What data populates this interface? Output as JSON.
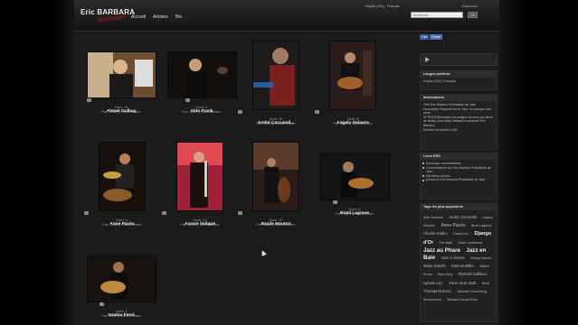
{
  "site": {
    "logo_text": "Eric BARBARA",
    "logo_sub": "Jazzimages"
  },
  "nav": [
    {
      "label": "Accueil"
    },
    {
      "label": "Artistes"
    },
    {
      "label": "Bio"
    }
  ],
  "top_links": {
    "lang_en": "English (US)",
    "sep": "|",
    "lang_fr": "Français",
    "login": "Connexion"
  },
  "search": {
    "placeholder": "rechercher",
    "button": "OK"
  },
  "albums": [
    {
      "name": "Ahmet Gulbay",
      "views": "Vues: 16",
      "owner": "Par: Gallery Administrator",
      "color": "#7a5a3a"
    },
    {
      "name": "Aldo Frank",
      "views": "Vues: 2",
      "owner": "Par: Gallery Administrator",
      "color": "#3a2d25"
    },
    {
      "name": "André Ceccarell...",
      "views": "Vues: 19",
      "owner": "Par: Gallery Administrator",
      "color": "#5a2020"
    },
    {
      "name": "Angelo Debarre",
      "views": "Vues: 8",
      "owner": "Par: Gallery Administrator",
      "color": "#3a2620"
    },
    {
      "name": "Anne Pacéo",
      "views": "Vues: 4",
      "owner": "Par: Gallery Administrator",
      "color": "#4a2a18"
    },
    {
      "name": "Aurore Voilqué",
      "views": "Vues: 37",
      "owner": "Par: Gallery Administrator",
      "color": "#b02840"
    },
    {
      "name": "Baxile Mouton",
      "views": "Vues: 10",
      "owner": "Par: Gallery Administrator",
      "color": "#3a2a20"
    },
    {
      "name": "Bireli Lagrene",
      "views": "Vues: 6",
      "owner": "Par: Gallery Administrator",
      "color": "#2a2a2a"
    },
    {
      "name": "Soulou Ferré",
      "views": "Vues: 6",
      "owner": "Par: Gallery Administrator",
      "color": "#2a1c14"
    }
  ],
  "sidebar": {
    "fb_like": "Like",
    "fb_share": "Share",
    "lang_title": "Langue préférée",
    "lang_en": "English (US)",
    "lang_sep": "|",
    "lang_fr": "Français",
    "info_title": "Informations",
    "info_lines": [
      "Titre Eric Barbara Portraitiste de Jazz",
      "Description Regards sur le Jazz, la musique des yeux.",
      "ATTENTION toutes ces images ne sont pas libres de droits, pour toute utilisation contacter Eric Barbara",
      "Nombre de photos 1264"
    ],
    "rss_title": "Liens RSS",
    "rss_items": [
      "Nouveaux commentaires",
      "Commentaires sur Eric Barbara Portraitiste de Jazz",
      "Dernières photos",
      "photos et Eric Barbara Portraitiste de Jazz"
    ],
    "tags_title": "Tags les plus populaires",
    "tags": [
      "Aldo Romano",
      "André Ceccarelli",
      "Angelo Debarre",
      "Anne Pacéo",
      "Bireli Lagrene",
      "Charlie Haden",
      "David Linx",
      "Django d'Or",
      "Eric Bibb",
      "Didier Lockwood",
      "Jazz au Phare",
      "Jazz en Baie",
      "Jazz à Vienne",
      "Kenny Garrett",
      "Manu Katché",
      "Marcus Miller",
      "Michel Portal",
      "Paco Séry",
      "Richard Galliano",
      "Sylvain Luc",
      "Youn Sun Nah",
      "Bireli",
      "Thomas Dutronc",
      "Stochelo Rosenberg",
      "Sanseverino",
      "Renaud Garcia-Fons"
    ]
  }
}
